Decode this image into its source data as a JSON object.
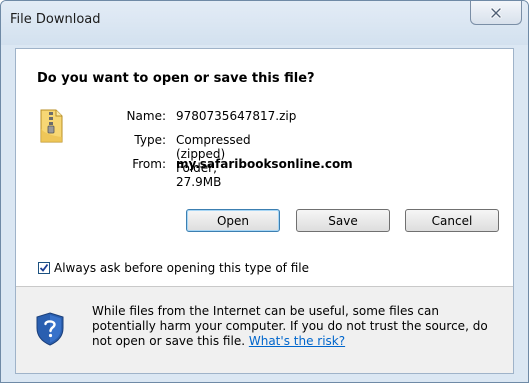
{
  "window": {
    "title": "File Download"
  },
  "dialog": {
    "question": "Do you want to open or save this file?",
    "fields": [
      {
        "label": "Name:",
        "value": "9780735647817.zip",
        "bold": false
      },
      {
        "label": "Type:",
        "value": "Compressed (zipped) Folder, 27.9MB",
        "bold": false
      },
      {
        "label": "From:",
        "value": "my.safaribooksonline.com",
        "bold": true
      }
    ],
    "buttons": {
      "open": "Open",
      "save": "Save",
      "cancel": "Cancel"
    },
    "checkbox": {
      "label": "Always ask before opening this type of file",
      "checked": true
    },
    "warning": {
      "text": "While files from the Internet can be useful, some files can potentially harm your computer. If you do not trust the source, do not open or save this file.",
      "link": "What's the risk?"
    }
  },
  "icons": {
    "file": "zip-folder-icon",
    "shield": "security-shield-icon",
    "close": "close-icon"
  },
  "colors": {
    "link": "#0066cc",
    "frame": "#dbe7f3",
    "warning_bg": "#f0f0f0",
    "shield": "#2a5fb0"
  }
}
